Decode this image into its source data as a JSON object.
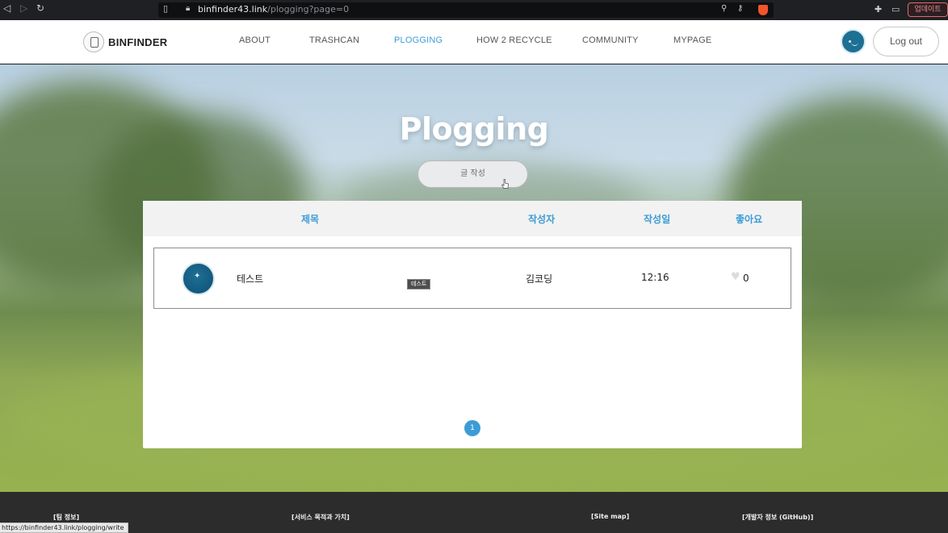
{
  "browser": {
    "url_host": "binfinder43.link",
    "url_path": "/plogging?page=0",
    "update_label": "업데이트",
    "status_url": "https://binfinder43.link/plogging/write"
  },
  "header": {
    "logo_text": "BINFINDER",
    "menu": [
      {
        "label": "ABOUT",
        "active": false
      },
      {
        "label": "TRASHCAN",
        "active": false
      },
      {
        "label": "PLOGGING",
        "active": true
      },
      {
        "label": "HOW 2 RECYCLE",
        "active": false
      },
      {
        "label": "COMMUNITY",
        "active": false
      },
      {
        "label": "MYPAGE",
        "active": false
      }
    ],
    "logout_label": "Log out"
  },
  "hero": {
    "title": "Plogging",
    "write_label": "글 작성"
  },
  "board": {
    "columns": [
      "제목",
      "작성자",
      "작성일",
      "좋아요"
    ],
    "posts": [
      {
        "title": "테스트",
        "author": "김코딩",
        "date": "12:16",
        "likes": "0",
        "tooltip": "테스트"
      }
    ],
    "pages": [
      "1"
    ],
    "current_page": "1"
  },
  "footer": {
    "headings": [
      "[팀 정보]",
      "[서비스 목적과 가치]",
      "[Site map]",
      "[개발자 정보 (GitHub)]"
    ]
  },
  "colors": {
    "accent": "#3d9cd6",
    "avatar": "#1d6f94",
    "footer_bg": "#2c2c2c",
    "chrome_bg": "#1f2023"
  }
}
